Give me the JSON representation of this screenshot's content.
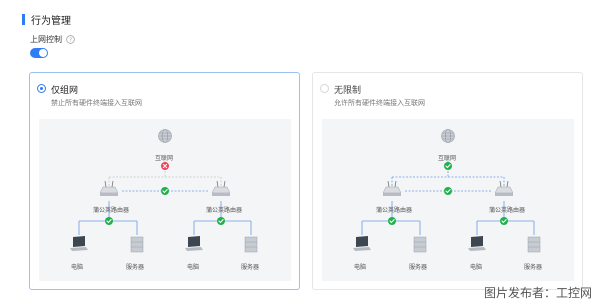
{
  "section": {
    "title": "行为管理"
  },
  "control": {
    "label": "上网控制",
    "toggle_on": true
  },
  "options": [
    {
      "title": "仅组网",
      "description": "禁止所有硬件终端接入互联网",
      "selected": true,
      "internet_label": "互联网",
      "router_left_label": "蒲公英路由器",
      "router_right_label": "蒲公英路由器",
      "pc_left_label": "电脑",
      "server_left_label": "服务器",
      "pc_right_label": "电脑",
      "server_right_label": "服务器",
      "internet_link_status": "blocked"
    },
    {
      "title": "无限制",
      "description": "允许所有硬件终端接入互联网",
      "selected": false,
      "internet_label": "互联网",
      "router_left_label": "蒲公英路由器",
      "router_right_label": "蒲公英路由器",
      "pc_left_label": "电脑",
      "server_left_label": "服务器",
      "pc_right_label": "电脑",
      "server_right_label": "服务器",
      "internet_link_status": "allowed"
    }
  ],
  "watermark": "图片发布者：工控网",
  "colors": {
    "accent": "#2f7cf6",
    "ok": "#20b24a",
    "blocked": "#e8455a"
  }
}
